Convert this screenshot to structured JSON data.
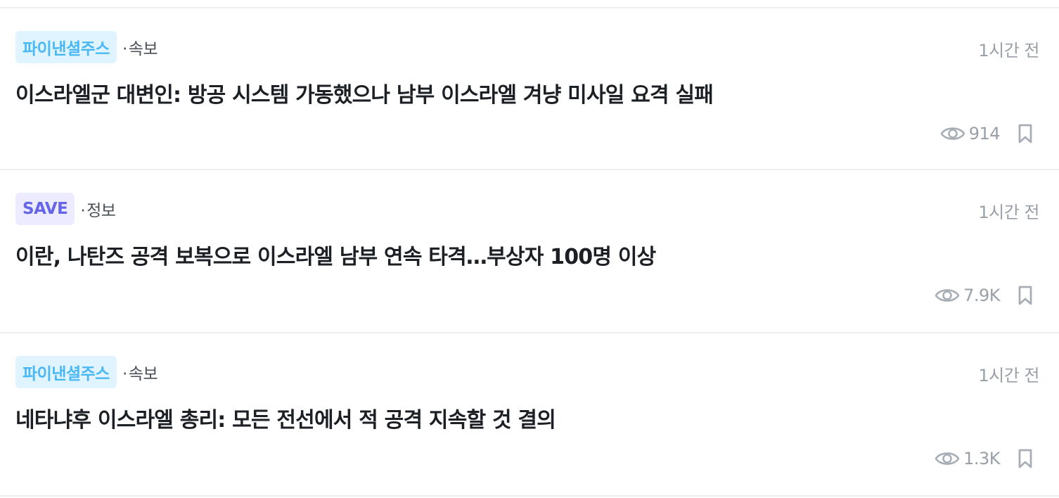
{
  "colors": {
    "finance_badge_bg": "#e0f4ff",
    "finance_badge_text": "#49b8f5",
    "save_badge_bg": "#ecebff",
    "save_badge_text": "#6565e8",
    "muted_text": "#9aa0a8",
    "headline_text": "#1c1f24",
    "divider": "#eceef1"
  },
  "feed": {
    "items": [
      {
        "source": "파이낸셜주스",
        "category_dot": "·",
        "category": "속보",
        "time": "1시간 전",
        "headline": "이스라엘군 대변인: 방공 시스템 가동했으나 남부 이스라엘 겨냥 미사일 요격 실패",
        "views": "914",
        "view_icon": "eye-icon",
        "bookmark_icon": "bookmark-icon"
      },
      {
        "source": "SAVE",
        "category_dot": "·",
        "category": "정보",
        "time": "1시간 전",
        "headline": "이란, 나탄즈 공격 보복으로 이스라엘 남부 연속 타격…부상자 100명 이상",
        "views": "7.9K",
        "view_icon": "eye-icon",
        "bookmark_icon": "bookmark-icon"
      },
      {
        "source": "파이낸셜주스",
        "category_dot": "·",
        "category": "속보",
        "time": "1시간 전",
        "headline": "네타냐후 이스라엘 총리: 모든 전선에서 적 공격 지속할 것 결의",
        "views": "1.3K",
        "view_icon": "eye-icon",
        "bookmark_icon": "bookmark-icon"
      }
    ]
  }
}
